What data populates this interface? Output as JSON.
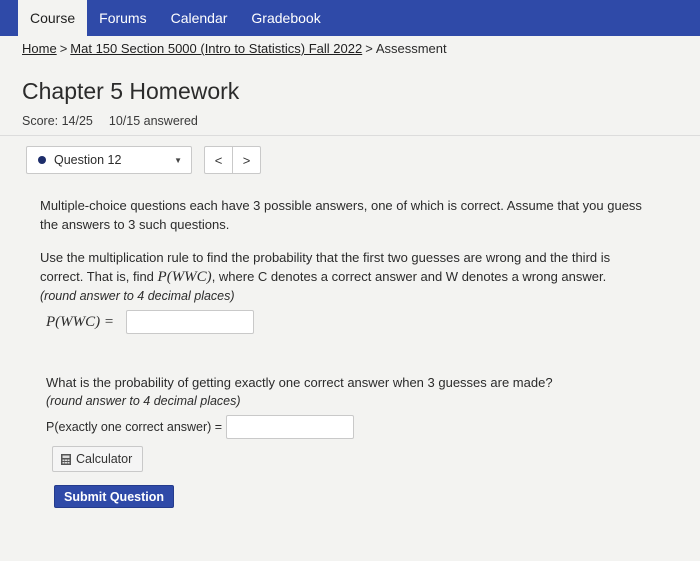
{
  "nav": {
    "tabs": [
      {
        "label": "Course",
        "active": true
      },
      {
        "label": "Forums"
      },
      {
        "label": "Calendar"
      },
      {
        "label": "Gradebook"
      }
    ]
  },
  "breadcrumb": {
    "home": "Home",
    "course": "Mat 150 Section 5000 (Intro to Statistics) Fall 2022",
    "current": "Assessment",
    "separator": ">"
  },
  "page": {
    "title": "Chapter 5 Homework",
    "score": "Score: 14/25",
    "answered": "10/15 answered"
  },
  "question_nav": {
    "selected": "Question 12",
    "prev": "<",
    "next": ">"
  },
  "question": {
    "intro": "Multiple-choice questions each have 3 possible answers, one of which is correct. Assume that you guess the answers to 3 such questions.",
    "part1_prefix": "Use the multiplication rule to find the probability that the first two guesses are wrong and the third is correct. That is, find ",
    "part1_math": "P(WWC)",
    "part1_suffix": ", where C denotes a correct answer and W denotes a wrong answer.",
    "part1_hint": "(round answer to 4 decimal places)",
    "part1_label": "P(WWC) =",
    "part1_value": "",
    "part2_text": "What is the probability of getting exactly one correct answer when 3 guesses are made?",
    "part2_hint": "(round answer to 4 decimal places)",
    "part2_label": "P(exactly one correct answer) =",
    "part2_value": ""
  },
  "buttons": {
    "calculator": "Calculator",
    "submit": "Submit Question"
  },
  "colors": {
    "nav_bg": "#2f4aa8",
    "page_bg": "#f3f3f1",
    "submit_bg": "#2f4aa8"
  }
}
